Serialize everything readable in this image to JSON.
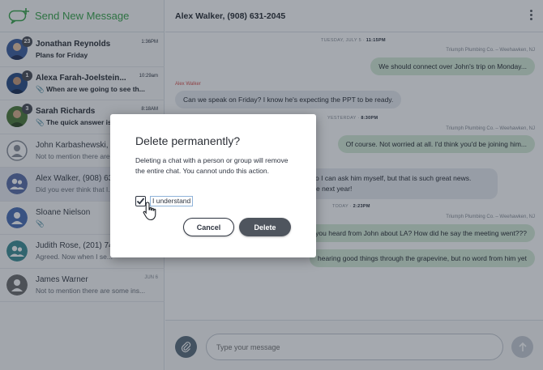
{
  "sidebar": {
    "title": "Send New Message",
    "conversations": [
      {
        "name": "Jonathan Reynolds",
        "time": "1:36PM",
        "preview": "Plans for Friday",
        "badge": "",
        "unread": true,
        "avatar_color": "#3f5f9e"
      },
      {
        "name": "Alexa Farah-Joelstein...",
        "time": "10:29am",
        "preview": "When are we going to see th...",
        "badge": "1",
        "unread": true,
        "avatar_color": "#2b4d85"
      },
      {
        "name": "Sarah Richards",
        "time": "8:18AM",
        "preview": "The quick answer is...",
        "badge": "3",
        "unread": true,
        "avatar_color": "#4e7a3a"
      },
      {
        "name": "John Karbashewski, (908)...",
        "time": "",
        "preview": "Not to mention there are...",
        "badge": "",
        "unread": false,
        "avatar_color": "#8a9099"
      },
      {
        "name": "Alex Walker, (908) 631-2045",
        "time": "",
        "preview": "Did you ever think that I...",
        "badge": "",
        "unread": false,
        "avatar_color": "#5a6ea8"
      },
      {
        "name": "Sloane Nielson",
        "time": "",
        "preview": "",
        "badge": "",
        "unread": false,
        "avatar_color": "#4a6fb5"
      },
      {
        "name": "Judith Rose, (201) 74...",
        "time": "",
        "preview": "Agreed. Now when I se...",
        "badge": "",
        "unread": false,
        "avatar_color": "#3e8e95"
      },
      {
        "name": "James Warner",
        "time": "JUN 6",
        "preview": "Not to mention there are some ins...",
        "badge": "",
        "unread": false,
        "avatar_color": "#6d6d6d"
      }
    ]
  },
  "main": {
    "title": "Alex Walker, (908) 631-2045",
    "messages": {
      "sep1_day": "TUESDAY, JULY 5",
      "sep1_time": "11:15PM",
      "meta1": "Triumph Plumbing Co. – Weehawken, NJ",
      "out1": "We should connect over John's trip on Monday...",
      "sender1": "Alex Walker",
      "in1": "Can we speak on Friday? I know he's expecting the PPT to be ready.",
      "sep2_day": "YESTERDAY",
      "sep2_time": "8:30PM",
      "meta2": "Triumph Plumbing Co. – Weehawken, NJ",
      "out2": "Of course. Not worried at all. I'd think you'd be joining him...",
      "in2a": "soon so I can ask him myself, but that is such great news.",
      "in2b": "over the next year!",
      "sep3_day": "TODAY",
      "sep3_time": "2:23PM",
      "meta3": "Triumph Plumbing Co. – Weehawken, NJ",
      "out3": "you heard from John about LA? How did he say the meeting went???",
      "out4": "hearing good things through the grapevine, but no word from him yet"
    },
    "composer": {
      "placeholder": "Type your message"
    }
  },
  "dialog": {
    "title": "Delete permanently?",
    "body": "Deleting a chat with a person or group will remove the entire chat. You cannot undo this action.",
    "confirm_label": "I understand",
    "confirm_checked": true,
    "cancel_label": "Cancel",
    "delete_label": "Delete"
  },
  "icons": [
    "compose-icon",
    "paperclip-icon",
    "send-arrow-icon",
    "kebab-menu-icon",
    "checkmark-icon",
    "hand-cursor-icon",
    "avatar-person-icon"
  ],
  "colors": {
    "brand_green": "#3aa54b",
    "outgoing_bubble": "#d6ecd8",
    "incoming_bubble": "#e8ebf0",
    "delete_button": "#4f555e",
    "sender_red": "#d9534f"
  }
}
